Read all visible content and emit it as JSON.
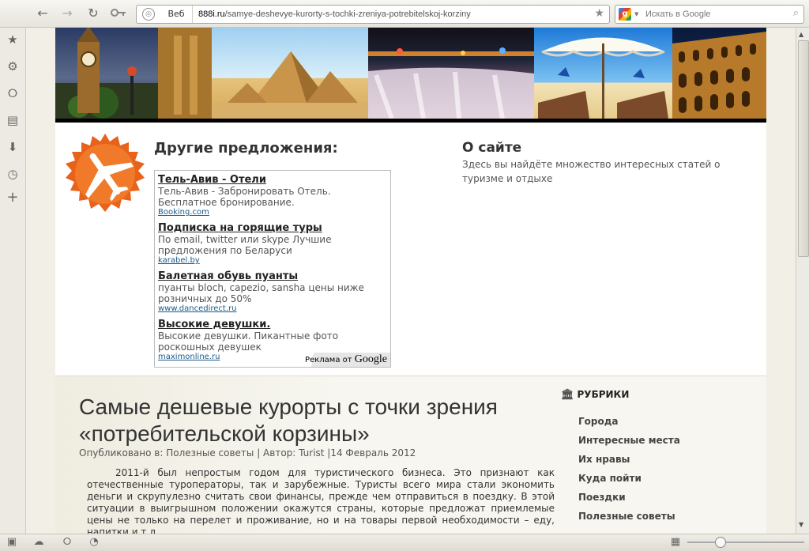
{
  "browser": {
    "zone_label": "Веб",
    "url_domain": "888i.ru",
    "url_path": "/samye-deshevye-kurorty-s-tochki-zreniya-potrebitelskoj-korziny",
    "search_placeholder": "Искать в Google"
  },
  "sidebar": {
    "icons": [
      "star-icon",
      "gear-icon",
      "share-icon",
      "notes-icon",
      "download-icon",
      "history-icon",
      "plus-icon"
    ]
  },
  "banner": {
    "panels": [
      "big-ben",
      "pyramids",
      "waterfall",
      "beach-umbrella",
      "colosseum"
    ]
  },
  "offers": {
    "title": "Другие предложения:",
    "ads": [
      {
        "title": "Тель-Авив - Отели",
        "desc": "Тель-Авив - Забронировать Отель. Бесплатное бронирование.",
        "url": "Booking.com"
      },
      {
        "title": "Подписка на горящие туры",
        "desc": "По email, twitter или skype Лучшие предложения по Беларуси",
        "url": "karabel.by"
      },
      {
        "title": "Балетная обувь пуанты",
        "desc": "пуанты bloch, capezio, sansha цены ниже розничных до 50%",
        "url": "www.dancedirect.ru"
      },
      {
        "title": "Высокие девушки.",
        "desc": "Высокие девушки. Пикантные фото роскошных девушек",
        "url": "maximonline.ru"
      }
    ],
    "ads_by_prefix": "Реклама от",
    "ads_by_brand": "Google"
  },
  "about": {
    "title": "О сайте",
    "text": "Здесь вы найдёте множество интересных статей о туризме и отдыхе"
  },
  "article": {
    "title": "Самые дешевые курорты с точки зрения «потребительской корзины»",
    "meta": "Опубликовано в: Полезные советы | Автор: Turist |14 Февраль 2012",
    "body": "2011-й был непростым годом для туристического бизнеса. Это признают как отечественные туроператоры, так и зарубежные. Туристы всего мира стали экономить деньги и скрупулезно считать свои финансы, прежде чем отправиться в поездку. В этой ситуации в выигрышном положении окажутся страны, которые предложат приемлемые цены не только на перелет и проживание, но и на товары первой необходимости – еду, напитки и т.д."
  },
  "rubrics": {
    "title": "РУБРИКИ",
    "items": [
      "Города",
      "Интересные места",
      "Их нравы",
      "Куда пойти",
      "Поездки",
      "Полезные советы"
    ]
  }
}
